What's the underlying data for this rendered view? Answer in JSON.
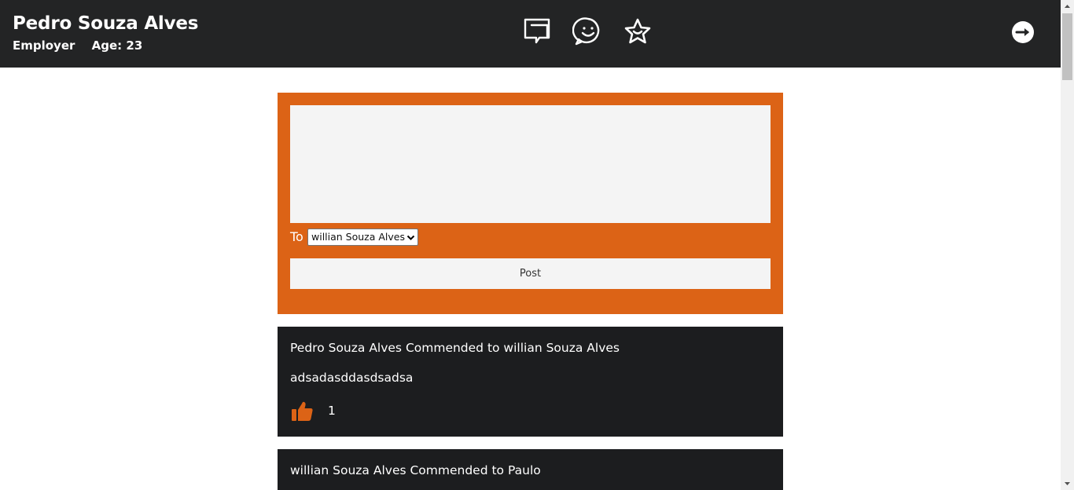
{
  "header": {
    "user_name": "Pedro Souza Alves",
    "role": "Employer",
    "age": "Age: 23",
    "nav_icons": [
      "chat-bubbles-icon",
      "smiley-chat-icon",
      "star-icon"
    ],
    "logout_icon": "logout-arrow-icon"
  },
  "composer": {
    "message_value": "",
    "to_label": "To",
    "recipient_selected": "willian Souza Alves",
    "post_label": "Post",
    "accent_color": "#dc6316"
  },
  "feed": [
    {
      "title": "Pedro Souza Alves Commended to willian Souza Alves",
      "body": "adsadasddasdsadsa",
      "likes": "1",
      "like_icon": "thumbs-up-icon"
    },
    {
      "title": "willian Souza Alves Commended to Paulo"
    }
  ],
  "colors": {
    "header_bg": "#232425",
    "card_bg": "#1c1d1f",
    "accent": "#dc6316"
  }
}
